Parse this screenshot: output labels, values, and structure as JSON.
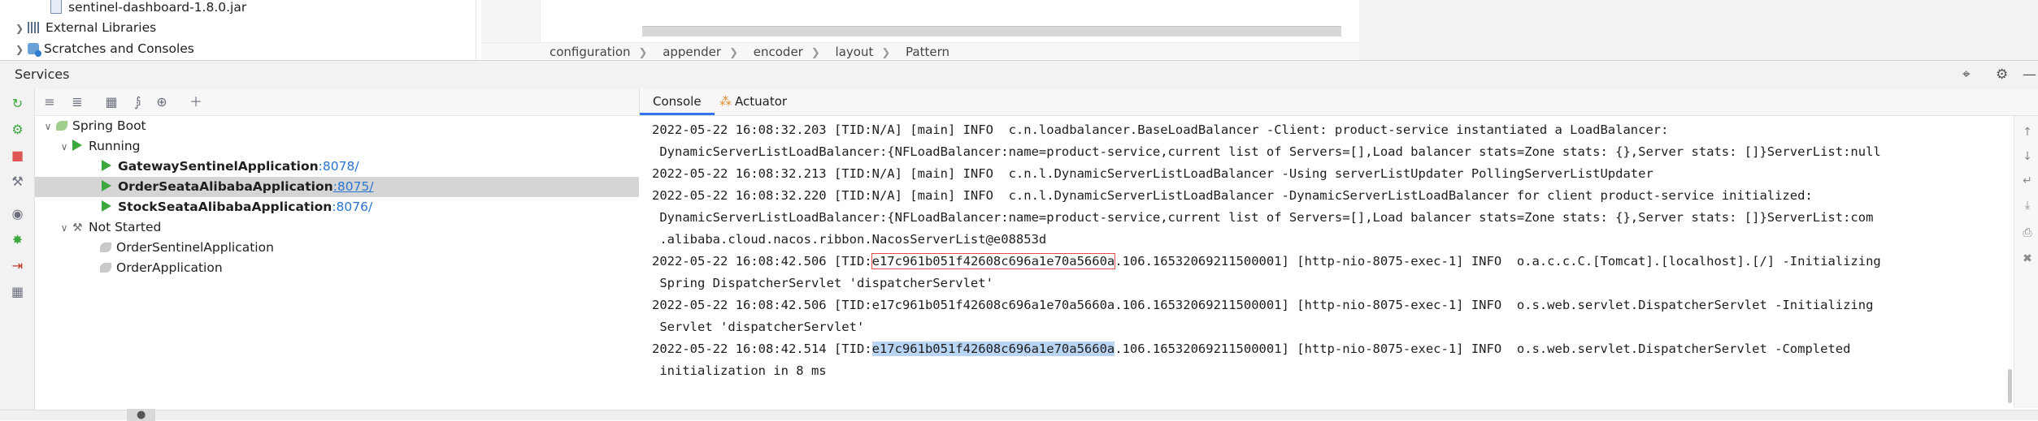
{
  "project_tree": {
    "items": [
      {
        "label": "sentinel-dashboard-1.8.0.jar"
      },
      {
        "label": "External Libraries"
      },
      {
        "label": "Scratches and Consoles"
      }
    ]
  },
  "breadcrumb": [
    "configuration",
    "appender",
    "encoder",
    "layout",
    "Pattern"
  ],
  "services": {
    "title": "Services",
    "tree": {
      "root": "Spring Boot",
      "running_label": "Running",
      "running": [
        {
          "name": "GatewaySentinelApplication",
          "port": ":8078/"
        },
        {
          "name": "OrderSeataAlibabaApplication",
          "port": ":8075/",
          "selected": true
        },
        {
          "name": "StockSeataAlibabaApplication",
          "port": ":8076/"
        }
      ],
      "not_started_label": "Not Started",
      "not_started": [
        {
          "name": "OrderSentinelApplication"
        },
        {
          "name": "OrderApplication"
        }
      ]
    }
  },
  "console": {
    "tabs": [
      {
        "label": "Console",
        "active": true
      },
      {
        "label": "Actuator",
        "active": false
      }
    ],
    "lines": [
      "2022-05-22 16:08:32.203 [TID:N/A] [main] INFO  c.n.loadbalancer.BaseLoadBalancer -Client: product-service instantiated a LoadBalancer:",
      " DynamicServerListLoadBalancer:{NFLoadBalancer:name=product-service,current list of Servers=[],Load balancer stats=Zone stats: {},Server stats: []}ServerList:null",
      "2022-05-22 16:08:32.213 [TID:N/A] [main] INFO  c.n.l.DynamicServerListLoadBalancer -Using serverListUpdater PollingServerListUpdater",
      "2022-05-22 16:08:32.220 [TID:N/A] [main] INFO  c.n.l.DynamicServerListLoadBalancer -DynamicServerListLoadBalancer for client product-service initialized:",
      " DynamicServerListLoadBalancer:{NFLoadBalancer:name=product-service,current list of Servers=[],Load balancer stats=Zone stats: {},Server stats: []}ServerList:com",
      " .alibaba.cloud.nacos.ribbon.NacosServerList@e08853d"
    ],
    "tid_lines": [
      {
        "pre": "2022-05-22 16:08:42.506 [TID:",
        "tid": "e17c961b051f42608c696a1e70a5660a",
        "post": ".106.16532069211500001] [http-nio-8075-exec-1] INFO  o.a.c.c.C.[Tomcat].[localhost].[/] -Initializing",
        "style": "boxed"
      },
      {
        "pre": "2022-05-22 16:08:42.506 [TID:",
        "tid": "e17c961b051f42608c696a1e70a5660a",
        "post": ".106.16532069211500001] [http-nio-8075-exec-1] INFO  o.s.web.servlet.DispatcherServlet -Initializing",
        "style": "plain"
      },
      {
        "pre": "2022-05-22 16:08:42.514 [TID:",
        "tid": "e17c961b051f42608c696a1e70a5660a",
        "post": ".106.16532069211500001] [http-nio-8075-exec-1] INFO  o.s.web.servlet.DispatcherServlet -Completed",
        "style": "highlight"
      }
    ],
    "continuations": [
      " Spring DispatcherServlet 'dispatcherServlet'",
      " Servlet 'dispatcherServlet'",
      " initialization in 8 ms"
    ]
  },
  "icons": {
    "rerun": "rerun-icon",
    "stop": "stop-icon",
    "settings": "gear-icon",
    "accent": "#3574f0",
    "run_green": "#3da83d",
    "port_blue": "#2875d2"
  }
}
